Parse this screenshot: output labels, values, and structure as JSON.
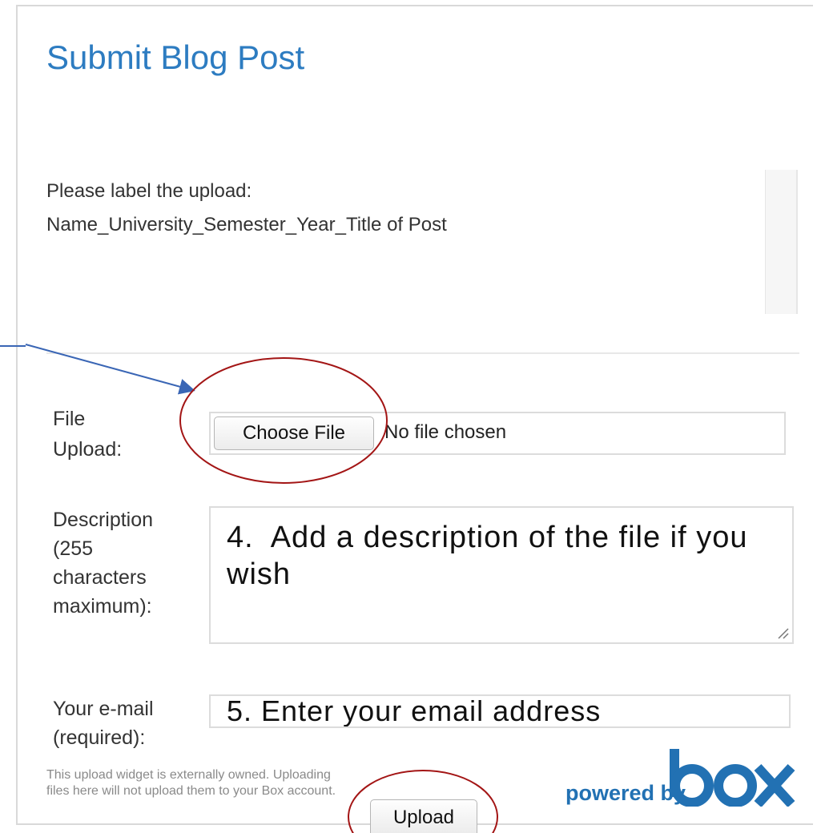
{
  "page": {
    "title": "Submit Blog Post",
    "instructions": {
      "line1": "Please label the upload:",
      "line2": "Name_University_Semester_Year_Title of Post"
    }
  },
  "form": {
    "file_upload": {
      "label_line1": "File",
      "label_line2": "Upload:",
      "button_label": "Choose File",
      "status_text": "No file chosen"
    },
    "description": {
      "label_line1": "Description",
      "label_line2": "(255",
      "label_line3": "characters",
      "label_line4": "maximum):",
      "value": "4.  Add a description of the file if you wish"
    },
    "email": {
      "label_line1": "Your e-mail",
      "label_line2": "(required):",
      "value": "5. Enter your email address"
    },
    "upload_button_label": "Upload"
  },
  "footer": {
    "disclaimer_line1": "This upload widget is externally owned. Uploading",
    "disclaimer_line2": "files here will not upload them to your Box account.",
    "powered_by": "powered by",
    "logo_text": "box"
  },
  "colors": {
    "title": "#2d7cc1",
    "annotation_circle": "#a31515",
    "annotation_arrow": "#3a66b5",
    "box_brand": "#2271b3"
  }
}
